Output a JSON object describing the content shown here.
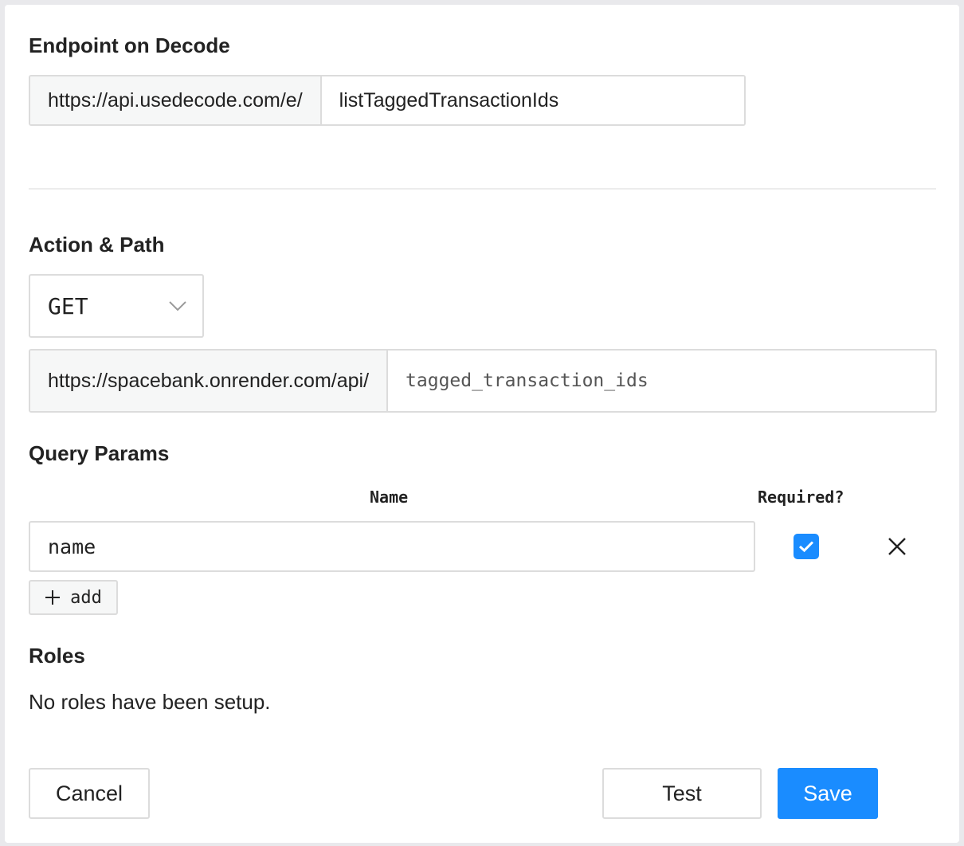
{
  "endpoint": {
    "title": "Endpoint on Decode",
    "prefix": "https://api.usedecode.com/e/",
    "value": "listTaggedTransactionIds"
  },
  "action": {
    "title": "Action & Path",
    "method": "GET",
    "path_prefix": "https://spacebank.onrender.com/api/",
    "path_value": "tagged_transaction_ids"
  },
  "query_params": {
    "title": "Query Params",
    "col_name": "Name",
    "col_required": "Required?",
    "rows": [
      {
        "name": "name",
        "required": true
      }
    ],
    "add_label": "add"
  },
  "roles": {
    "title": "Roles",
    "empty_text": "No roles have been setup."
  },
  "footer": {
    "cancel_label": "Cancel",
    "test_label": "Test",
    "save_label": "Save"
  },
  "colors": {
    "primary": "#1a8cff",
    "border": "#dcdcdc",
    "addon_bg": "#f6f7f7"
  },
  "icons": {
    "select": "chevron-down-icon",
    "checkbox": "check-icon",
    "remove": "close-icon",
    "add": "plus-icon"
  }
}
